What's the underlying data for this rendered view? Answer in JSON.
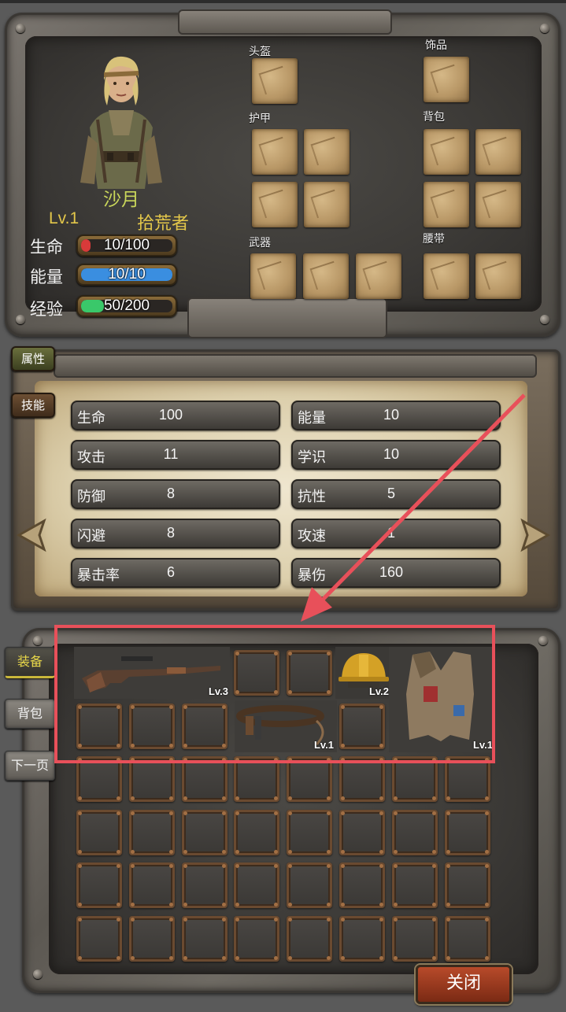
{
  "character": {
    "name": "沙月",
    "level": "Lv.1",
    "job": "拾荒者",
    "stats": [
      {
        "label": "生命",
        "text": "10/100",
        "ratio": 0.1,
        "color": "#d83a3a"
      },
      {
        "label": "能量",
        "text": "10/10",
        "ratio": 1.0,
        "color": "#3a8ee0"
      },
      {
        "label": "经验",
        "text": "50/200",
        "ratio": 0.25,
        "color": "#3ac86a"
      }
    ]
  },
  "equip_slots": {
    "helmet": "头盔",
    "accessory": "饰品",
    "armor": "护甲",
    "backpack": "背包",
    "weapon": "武器",
    "belt": "腰带"
  },
  "tabs": {
    "attributes": "属性",
    "skills": "技能"
  },
  "attributes": [
    {
      "label": "生命",
      "value": "100"
    },
    {
      "label": "能量",
      "value": "10"
    },
    {
      "label": "攻击",
      "value": "11"
    },
    {
      "label": "学识",
      "value": "10"
    },
    {
      "label": "防御",
      "value": "8"
    },
    {
      "label": "抗性",
      "value": "5"
    },
    {
      "label": "闪避",
      "value": "8"
    },
    {
      "label": "攻速",
      "value": "1"
    },
    {
      "label": "暴击率",
      "value": "6"
    },
    {
      "label": "暴伤",
      "value": "160"
    }
  ],
  "side_tabs": {
    "equipment": "装备",
    "bag": "背包",
    "next_page": "下一页"
  },
  "items": {
    "rifle": "Lv.3",
    "helmet": "Lv.2",
    "belt": "Lv.1",
    "vest": "Lv.1"
  },
  "close_button": "关闭",
  "colors": {
    "highlight": "#e8505a",
    "arrow": "#e8505a",
    "gold_text": "#e3c74a"
  }
}
